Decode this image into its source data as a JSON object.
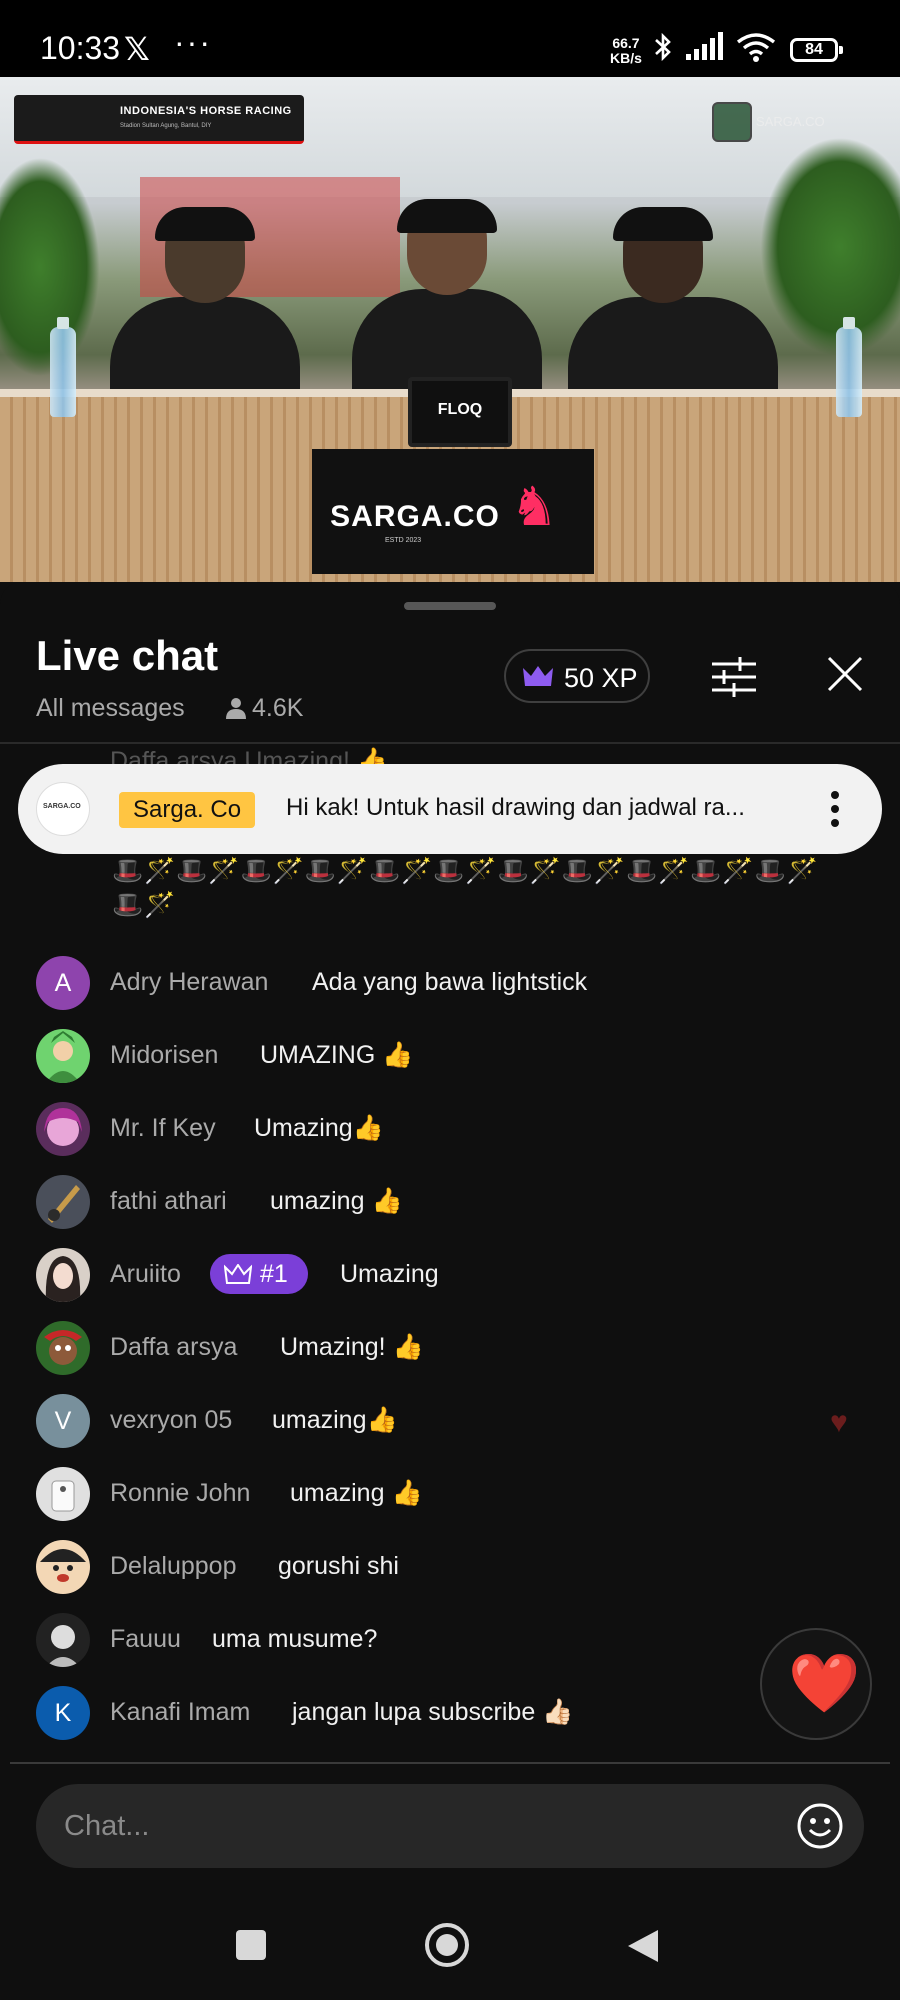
{
  "status_bar": {
    "time": "10:33",
    "x_indicator": "𝕏",
    "more": "···",
    "net_speed_value": "66.7",
    "net_speed_unit": "KB/s",
    "battery": "84"
  },
  "video": {
    "banner_title": "INDONESIA'S HORSE RACING",
    "banner_subtitle": "Stadion Sultan Agung, Bantul, DIY",
    "sign_text": "SARGA.CO",
    "sign_subtext": "ESTD 2023",
    "monitor_text": "FLOQ",
    "watermark": "SARGA.CO"
  },
  "chat_header": {
    "title": "Live chat",
    "filter_label": "All messages",
    "viewer_count": "4.6K",
    "xp_label": "50 XP"
  },
  "pinned": {
    "author_badge": "Sarga. Co",
    "text": "Hi kak! Untuk hasil drawing dan jadwal ra...",
    "logo_text": "SARGA.CO",
    "ghost_author": "Daffa arsya   Umazing! 👍"
  },
  "emoji_rows": [
    "🎩🪄🎩🪄🎩🪄🎩🪄🎩🪄🎩🪄🎩🪄🎩🪄🎩🪄🎩🪄🎩🪄",
    "🎩🪄🎩🪄🎩🪄🎩🪄🎩🪄🎩🪄🎩🪄🎩🪄🎩🪄🎩🪄🎩🪄",
    "🎩🪄"
  ],
  "messages": [
    {
      "author": "Adry Herawan",
      "text": "Ada yang bawa lightstick",
      "avatar_letter": "A",
      "avatar_color": "#8e44ad"
    },
    {
      "author": "Midorisen",
      "text": "UMAZING 👍",
      "avatar_letter": "",
      "avatar_color": "#6fd36f"
    },
    {
      "author": "Mr. If Key",
      "text": "Umazing👍",
      "avatar_letter": "",
      "avatar_color": "#5a2d5c"
    },
    {
      "author": "fathi athari",
      "text": "umazing 👍",
      "avatar_letter": "",
      "avatar_color": "#4a4f5a"
    },
    {
      "author": "Aruiito",
      "text": "Umazing",
      "avatar_letter": "",
      "avatar_color": "#d9d0c8",
      "rank": "#1"
    },
    {
      "author": "Daffa arsya",
      "text": "Umazing! 👍",
      "avatar_letter": "",
      "avatar_color": "#2f6b2a"
    },
    {
      "author": "vexryon 05",
      "text": "umazing👍",
      "avatar_letter": "V",
      "avatar_color": "#78909c"
    },
    {
      "author": "Ronnie John",
      "text": "umazing 👍",
      "avatar_letter": "",
      "avatar_color": "#e0e0e0"
    },
    {
      "author": "Delaluppop",
      "text": "gorushi shi",
      "avatar_letter": "",
      "avatar_color": "#f3d7b5"
    },
    {
      "author": "Fauuu",
      "text": "uma musume?",
      "avatar_letter": "",
      "avatar_color": "#222222"
    },
    {
      "author": "Kanafi Imam",
      "text": "jangan lupa subscribe 👍🏻",
      "avatar_letter": "K",
      "avatar_color": "#0b5cad"
    }
  ],
  "reaction": {
    "heart": "❤️",
    "floating_heart": "♥"
  },
  "input": {
    "placeholder": "Chat..."
  },
  "colors": {
    "accent_purple": "#7b3fd8",
    "pinned_badge": "#ffc542",
    "brand_pink": "#ff2e63"
  }
}
